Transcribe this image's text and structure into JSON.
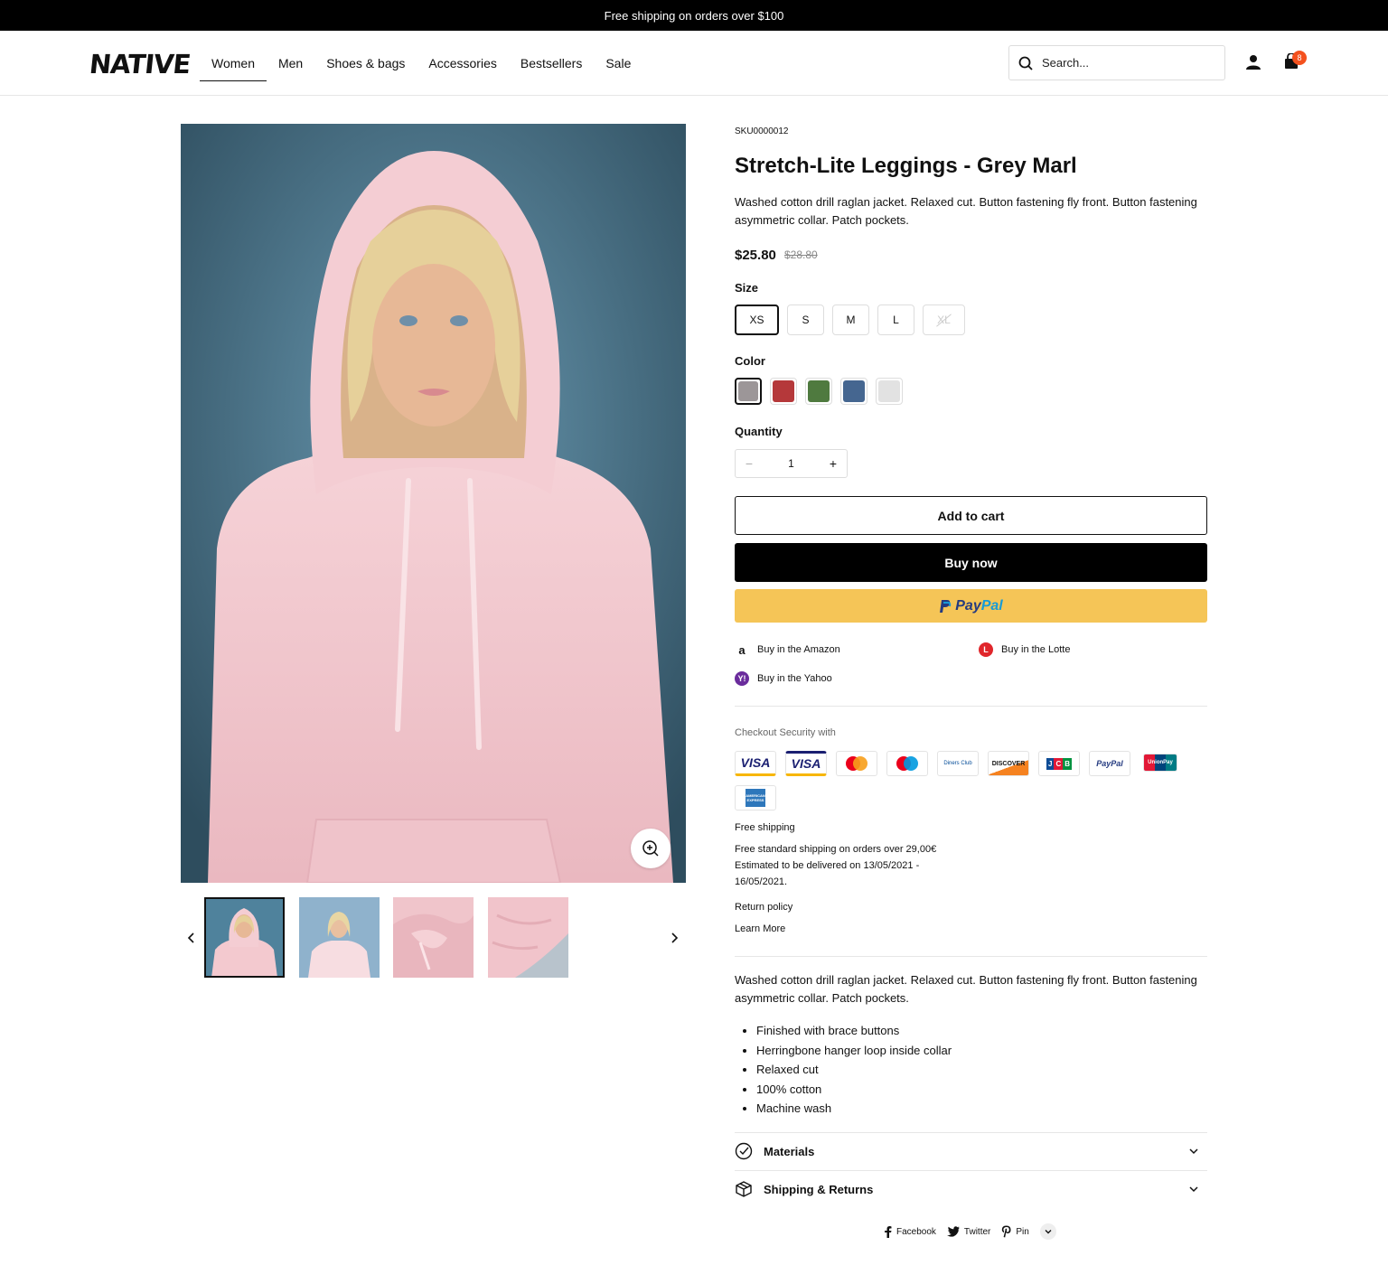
{
  "announcement": "Free shipping on orders over $100",
  "header": {
    "logo": "NATIVE",
    "nav": [
      "Women",
      "Men",
      "Shoes & bags",
      "Accessories",
      "Bestsellers",
      "Sale"
    ],
    "active_nav": "Women",
    "search_placeholder": "Search...",
    "cart_count": "8",
    "icons": [
      "search-icon",
      "user-icon",
      "cart-icon"
    ]
  },
  "product": {
    "sku": "SKU0000012",
    "title": "Stretch-Lite Leggings - Grey Marl",
    "description": "Washed cotton drill raglan jacket. Relaxed cut. Button fastening fly front. Button fastening asymmetric collar. Patch pockets.",
    "price": "$25.80",
    "compare_price": "$28.80",
    "size_label": "Size",
    "sizes": [
      "XS",
      "S",
      "M",
      "L",
      "XL"
    ],
    "selected_size": "XS",
    "unavailable_size": "XL",
    "color_label": "Color",
    "colors": [
      "#9c9698",
      "#b5383a",
      "#4f7a3f",
      "#456690",
      "#e2e2e2"
    ],
    "selected_color": "#9c9698",
    "quantity_label": "Quantity",
    "quantity": "1",
    "add_to_cart": "Add to cart",
    "buy_now": "Buy now",
    "paypal_a": "Pay",
    "paypal_b": "Pal",
    "stores": [
      "Buy in the Amazon",
      "Buy in the Lotte",
      "Buy in the Yahoo"
    ],
    "checkout_security": "Checkout Security with",
    "payment_methods": [
      "VISA",
      "VISA",
      "mastercard",
      "maestro",
      "Diners Club",
      "DISCOVER",
      "JCB",
      "PayPal",
      "UnionPay",
      "AMERICAN EXPRESS"
    ],
    "free_shipping_title": "Free shipping",
    "free_shipping_text_1": "Free standard shipping on orders over 29,00€",
    "free_shipping_text_2": "Estimated to be delivered on 13/05/2021 -",
    "free_shipping_text_3": "16/05/2021.",
    "return_policy": "Return policy",
    "learn_more": "Learn More",
    "long_description": "Washed cotton drill raglan jacket. Relaxed cut. Button fastening fly front. Button fastening asymmetric collar. Patch pockets.",
    "features": [
      "Finished with brace buttons",
      "Herringbone hanger loop inside collar",
      "Relaxed cut",
      "100% cotton",
      "Machine wash"
    ],
    "accordions": [
      "Materials",
      "Shipping & Returns"
    ],
    "share": [
      "Facebook",
      "Twitter",
      "Pin"
    ]
  },
  "colors": {
    "accent_badge": "#f4511e",
    "paypal_yellow": "#f5c557",
    "image_bg": "#5e8fa8",
    "hoodie_pink": "#f3c9cf"
  }
}
